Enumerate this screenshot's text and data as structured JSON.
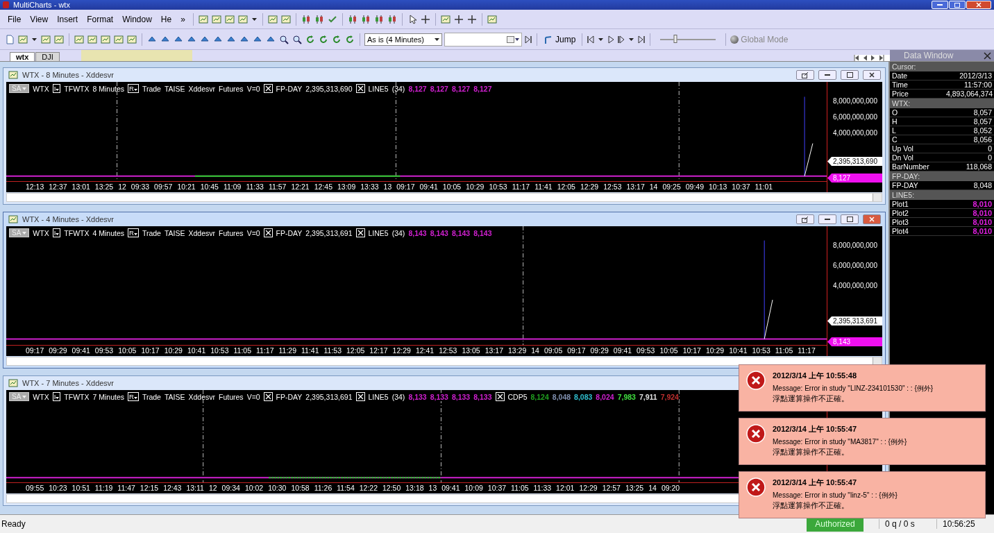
{
  "window": {
    "title": "MultiCharts - wtx"
  },
  "menu": [
    "File",
    "View",
    "Insert",
    "Format",
    "Window",
    "He",
    "»"
  ],
  "toolbar": {
    "resolution": "As is (4 Minutes)",
    "jump_label": "Jump",
    "speed_slider": {
      "level": 0.27
    },
    "mode_label": "Global Mode"
  },
  "tabs": [
    {
      "label": "wtx",
      "selected": true
    },
    {
      "label": "DJI",
      "selected": false
    }
  ],
  "data_window": {
    "title": "Data Window",
    "rows": [
      {
        "kind": "header",
        "label": "Cursor:"
      },
      {
        "kind": "row",
        "label": "Date",
        "value": "2012/3/13"
      },
      {
        "kind": "row",
        "label": "Time",
        "value": "11:57:00"
      },
      {
        "kind": "row",
        "label": "Price",
        "value": "4,893,064,374"
      },
      {
        "kind": "header",
        "label": "WTX:"
      },
      {
        "kind": "row",
        "label": "O",
        "value": "8,057"
      },
      {
        "kind": "row",
        "label": "H",
        "value": "8,057"
      },
      {
        "kind": "row",
        "label": "L",
        "value": "8,052"
      },
      {
        "kind": "row",
        "label": "C",
        "value": "8,056"
      },
      {
        "kind": "row",
        "label": "Up Vol",
        "value": "0"
      },
      {
        "kind": "row",
        "label": "Dn Vol",
        "value": "0"
      },
      {
        "kind": "row",
        "label": "BarNumber",
        "value": "118,068"
      },
      {
        "kind": "header",
        "label": "FP-DAY:"
      },
      {
        "kind": "row",
        "label": "FP-DAY",
        "value": "8,048"
      },
      {
        "kind": "header",
        "label": "LINE5:"
      },
      {
        "kind": "row",
        "label": "Plot1",
        "value": "8,010",
        "color": "#e020e0"
      },
      {
        "kind": "row",
        "label": "Plot2",
        "value": "8,010",
        "color": "#e020e0"
      },
      {
        "kind": "row",
        "label": "Plot3",
        "value": "8,010",
        "color": "#e020e0"
      },
      {
        "kind": "row",
        "label": "Plot4",
        "value": "8,010",
        "color": "#e020e0"
      }
    ]
  },
  "charts": [
    {
      "title": "WTX - 8 Minutes - Xddesvr",
      "active": false,
      "legend": [
        {
          "kind": "sa",
          "text": "SA"
        },
        {
          "kind": "text",
          "text": "WTX"
        },
        {
          "kind": "menu",
          "text": "I"
        },
        {
          "kind": "text",
          "text": "TFWTX"
        },
        {
          "kind": "text",
          "text": "8 Minutes"
        },
        {
          "kind": "menu",
          "text": "R"
        },
        {
          "kind": "text",
          "text": "Trade"
        },
        {
          "kind": "text",
          "text": "TAISE"
        },
        {
          "kind": "text",
          "text": "Xddesvr"
        },
        {
          "kind": "text",
          "text": "Futures"
        },
        {
          "kind": "text",
          "text": "V=0"
        },
        {
          "kind": "box"
        },
        {
          "kind": "text",
          "text": "FP-DAY"
        },
        {
          "kind": "text",
          "text": "2,395,313,690"
        },
        {
          "kind": "box"
        },
        {
          "kind": "text",
          "text": "LINE5"
        },
        {
          "kind": "text",
          "text": "(34)"
        },
        {
          "kind": "value",
          "text": "8,127",
          "color": "#d020d0"
        },
        {
          "kind": "value",
          "text": "8,127",
          "color": "#d020d0"
        },
        {
          "kind": "value",
          "text": "8,127",
          "color": "#d020d0"
        },
        {
          "kind": "value",
          "text": "8,127",
          "color": "#d020d0"
        }
      ],
      "y_ticks": [
        "8,000,000,000",
        "6,000,000,000",
        "4,000,000,000"
      ],
      "volume_tag": "2,395,313,690",
      "price_tag": "8,127",
      "times": [
        "12:13",
        "12:37",
        "13:01",
        "13:25",
        "12",
        "09:33",
        "09:57",
        "10:21",
        "10:45",
        "11:09",
        "11:33",
        "11:57",
        "12:21",
        "12:45",
        "13:09",
        "13:33",
        "13",
        "09:17",
        "09:41",
        "10:05",
        "10:29",
        "10:53",
        "11:17",
        "11:41",
        "12:05",
        "12:29",
        "12:53",
        "13:17",
        "14",
        "09:25",
        "09:49",
        "10:13",
        "10:37",
        "11:01"
      ]
    },
    {
      "title": "WTX - 4 Minutes - Xddesvr",
      "active": true,
      "legend": [
        {
          "kind": "sa",
          "text": "SA"
        },
        {
          "kind": "text",
          "text": "WTX"
        },
        {
          "kind": "menu",
          "text": "I"
        },
        {
          "kind": "text",
          "text": "TFWTX"
        },
        {
          "kind": "text",
          "text": "4 Minutes"
        },
        {
          "kind": "menu",
          "text": "R"
        },
        {
          "kind": "text",
          "text": "Trade"
        },
        {
          "kind": "text",
          "text": "TAISE"
        },
        {
          "kind": "text",
          "text": "Xddesvr"
        },
        {
          "kind": "text",
          "text": "Futures"
        },
        {
          "kind": "text",
          "text": "V=0"
        },
        {
          "kind": "box"
        },
        {
          "kind": "text",
          "text": "FP-DAY"
        },
        {
          "kind": "text",
          "text": "2,395,313,691"
        },
        {
          "kind": "box"
        },
        {
          "kind": "text",
          "text": "LINE5"
        },
        {
          "kind": "text",
          "text": "(34)"
        },
        {
          "kind": "value",
          "text": "8,143",
          "color": "#d020d0"
        },
        {
          "kind": "value",
          "text": "8,143",
          "color": "#d020d0"
        },
        {
          "kind": "value",
          "text": "8,143",
          "color": "#d020d0"
        },
        {
          "kind": "value",
          "text": "8,143",
          "color": "#d020d0"
        }
      ],
      "y_ticks": [
        "8,000,000,000",
        "6,000,000,000",
        "4,000,000,000"
      ],
      "volume_tag": "2,395,313,691",
      "price_tag": "8,143",
      "times": [
        "09:17",
        "09:29",
        "09:41",
        "09:53",
        "10:05",
        "10:17",
        "10:29",
        "10:41",
        "10:53",
        "11:05",
        "11:17",
        "11:29",
        "11:41",
        "11:53",
        "12:05",
        "12:17",
        "12:29",
        "12:41",
        "12:53",
        "13:05",
        "13:17",
        "13:29",
        "14",
        "09:05",
        "09:17",
        "09:29",
        "09:41",
        "09:53",
        "10:05",
        "10:17",
        "10:29",
        "10:41",
        "10:53",
        "11:05",
        "11:17"
      ]
    },
    {
      "title": "WTX - 7 Minutes - Xddesvr",
      "active": false,
      "legend": [
        {
          "kind": "sa",
          "text": "SA"
        },
        {
          "kind": "text",
          "text": "WTX"
        },
        {
          "kind": "menu",
          "text": "I"
        },
        {
          "kind": "text",
          "text": "TFWTX"
        },
        {
          "kind": "text",
          "text": "7 Minutes"
        },
        {
          "kind": "menu",
          "text": "R"
        },
        {
          "kind": "text",
          "text": "Trade"
        },
        {
          "kind": "text",
          "text": "TAISE"
        },
        {
          "kind": "text",
          "text": "Xddesvr"
        },
        {
          "kind": "text",
          "text": "Futures"
        },
        {
          "kind": "text",
          "text": "V=0"
        },
        {
          "kind": "box"
        },
        {
          "kind": "text",
          "text": "FP-DAY"
        },
        {
          "kind": "text",
          "text": "2,395,313,691"
        },
        {
          "kind": "box"
        },
        {
          "kind": "text",
          "text": "LINE5"
        },
        {
          "kind": "text",
          "text": "(34)"
        },
        {
          "kind": "value",
          "text": "8,133",
          "color": "#d020d0"
        },
        {
          "kind": "value",
          "text": "8,133",
          "color": "#d020d0"
        },
        {
          "kind": "value",
          "text": "8,133",
          "color": "#d020d0"
        },
        {
          "kind": "value",
          "text": "8,133",
          "color": "#d020d0"
        },
        {
          "kind": "box"
        },
        {
          "kind": "text",
          "text": "CDP5"
        },
        {
          "kind": "value",
          "text": "8,124",
          "color": "#20a020"
        },
        {
          "kind": "value",
          "text": "8,048",
          "color": "#8090b0"
        },
        {
          "kind": "value",
          "text": "8,083",
          "color": "#30c0d0"
        },
        {
          "kind": "value",
          "text": "8,024",
          "color": "#d020d0"
        },
        {
          "kind": "value",
          "text": "7,983",
          "color": "#40e040"
        },
        {
          "kind": "value",
          "text": "7,911",
          "color": "#e0e0e0"
        },
        {
          "kind": "value",
          "text": "7,924",
          "color": "#c03030"
        }
      ],
      "times": [
        "09:55",
        "10:23",
        "10:51",
        "11:19",
        "11:47",
        "12:15",
        "12:43",
        "13:11",
        "12",
        "09:34",
        "10:02",
        "10:30",
        "10:58",
        "11:26",
        "11:54",
        "12:22",
        "12:50",
        "13:18",
        "13",
        "09:41",
        "10:09",
        "10:37",
        "11:05",
        "11:33",
        "12:01",
        "12:29",
        "12:57",
        "13:25",
        "14",
        "09:20"
      ]
    }
  ],
  "notifications": [
    {
      "time": "2012/3/14 上午 10:55:48",
      "message": "Message: Error in study \"LINZ-234101530\" : : {例外}",
      "detail": "浮點運算操作不正確。"
    },
    {
      "time": "2012/3/14 上午 10:55:47",
      "message": "Message: Error in study \"MA3817\" : : {例外}",
      "detail": "浮點運算操作不正確。"
    },
    {
      "time": "2012/3/14 上午 10:55:47",
      "message": "Message: Error in study \"linz-5\" : : {例外}",
      "detail": "浮點運算操作不正確。"
    }
  ],
  "status_bar": {
    "text": "Ready",
    "connection": "Authorized",
    "queue": "0 q / 0 s",
    "clock": "10:56:25"
  }
}
